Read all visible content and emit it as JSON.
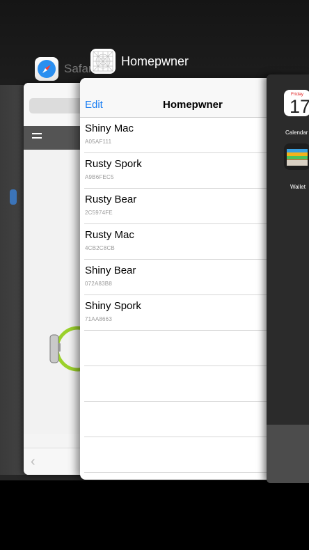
{
  "app_labels": {
    "safari": "Safari",
    "homepwner": "Homepwner"
  },
  "homepwner": {
    "nav": {
      "edit_label": "Edit",
      "title": "Homepwner"
    },
    "items": [
      {
        "name": "Shiny Mac",
        "serial": "A05AF111"
      },
      {
        "name": "Rusty Spork",
        "serial": "A9B6FEC5"
      },
      {
        "name": "Rusty Bear",
        "serial": "2C5974FE"
      },
      {
        "name": "Rusty Mac",
        "serial": "4CB2C8CB"
      },
      {
        "name": "Shiny Bear",
        "serial": "072A83B8"
      },
      {
        "name": "Shiny Spork",
        "serial": "71AA8663"
      }
    ]
  },
  "home_screen": {
    "calendar": {
      "day": "Friday",
      "date": "17",
      "label": "Calendar"
    },
    "wallet": {
      "label": "Wallet"
    }
  },
  "colors": {
    "ios_blue": "#1a7ef2",
    "background": "#000000"
  }
}
